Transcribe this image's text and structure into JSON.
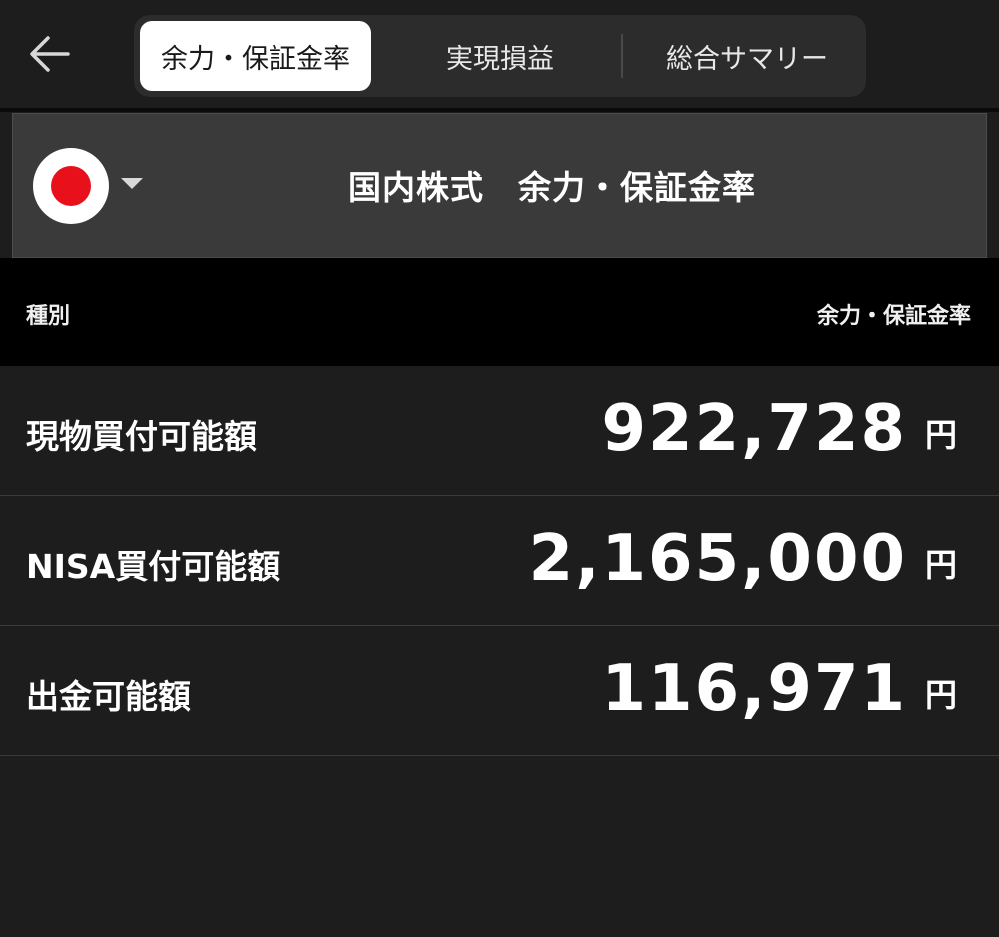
{
  "tabs": [
    {
      "label": "余力・保証金率",
      "active": true
    },
    {
      "label": "実現損益",
      "active": false
    },
    {
      "label": "総合サマリー",
      "active": false
    }
  ],
  "market": {
    "flag": "japan-flag-icon",
    "title": "国内株式　余力・保証金率"
  },
  "table": {
    "header_left": "種別",
    "header_right": "余力・保証金率",
    "rows": [
      {
        "label": "現物買付可能額",
        "value": "922,728",
        "unit": "円"
      },
      {
        "label": "NISA買付可能額",
        "value": "2,165,000",
        "unit": "円"
      },
      {
        "label": "出金可能額",
        "value": "116,971",
        "unit": "円"
      }
    ]
  },
  "colors": {
    "background": "#1d1d1d",
    "header_bg": "#3a3a3a",
    "column_header_bg": "#000000",
    "active_tab_bg": "#ffffff",
    "flag_red": "#e8101b"
  }
}
